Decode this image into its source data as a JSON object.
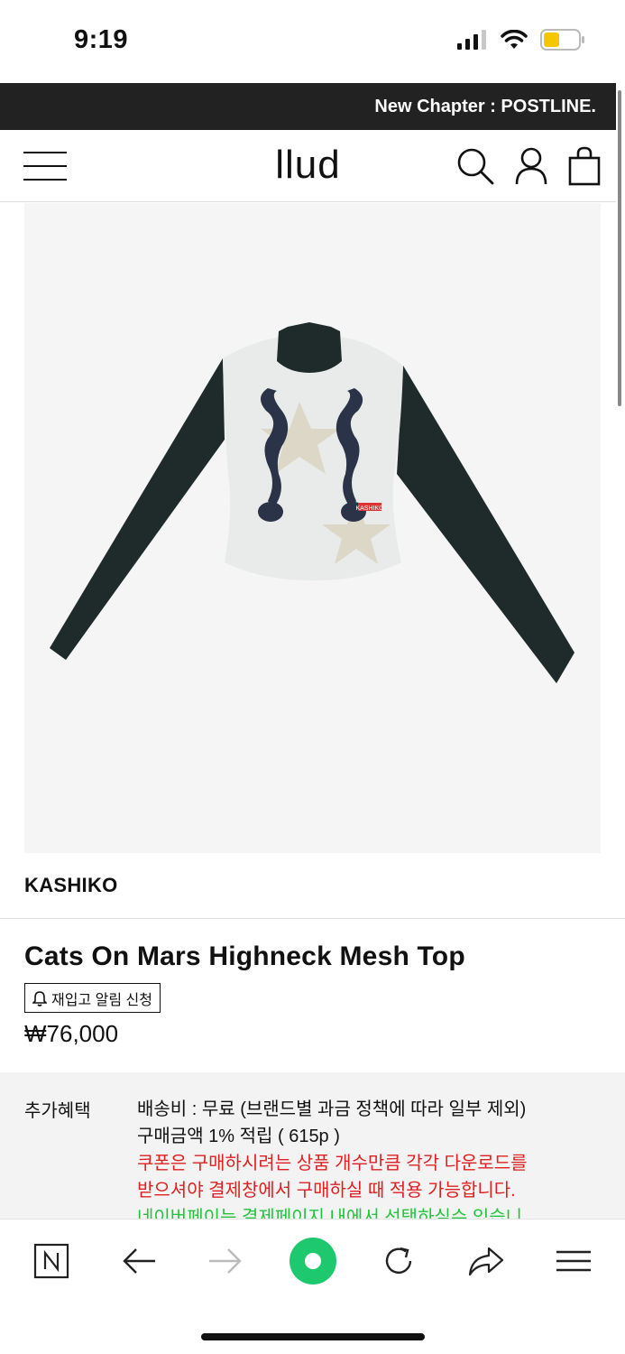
{
  "status_bar": {
    "time": "9:19"
  },
  "announcement": "New Chapter : POSTLINE.",
  "header": {
    "logo": "llud"
  },
  "product": {
    "brand": "KASHIKO",
    "title": "Cats On Mars Highneck Mesh Top",
    "restock_label": "재입고 알림 신청",
    "price": "₩76,000",
    "shirt_tag": "KASHIKO"
  },
  "benefits": {
    "label": "추가혜택",
    "shipping": "배송비 : 무료 (브랜드별 과금 정책에 따라 일부 제외)",
    "points": "구매금액 1% 적립 ( 615p )",
    "coupon_line1": "쿠폰은 구매하시려는 상품 개수만큼 각각 다운로드를",
    "coupon_line2": "받으셔야 결제창에서 구매하실 때 적용 가능합니다.",
    "naverpay_line": "네이버페이는 결제페이지 내에서 선택하실수 있습니"
  },
  "colors": {
    "accent_green": "#1ec86e",
    "coupon_red": "#e02020",
    "naverpay_green": "#23c33c",
    "announce_bg": "#222222"
  },
  "icons": [
    "menu-icon",
    "search-icon",
    "user-icon",
    "bag-icon",
    "n-icon",
    "back-arrow-icon",
    "forward-arrow-icon",
    "home-dot-icon",
    "refresh-icon",
    "share-icon",
    "menu-lines-icon"
  ]
}
